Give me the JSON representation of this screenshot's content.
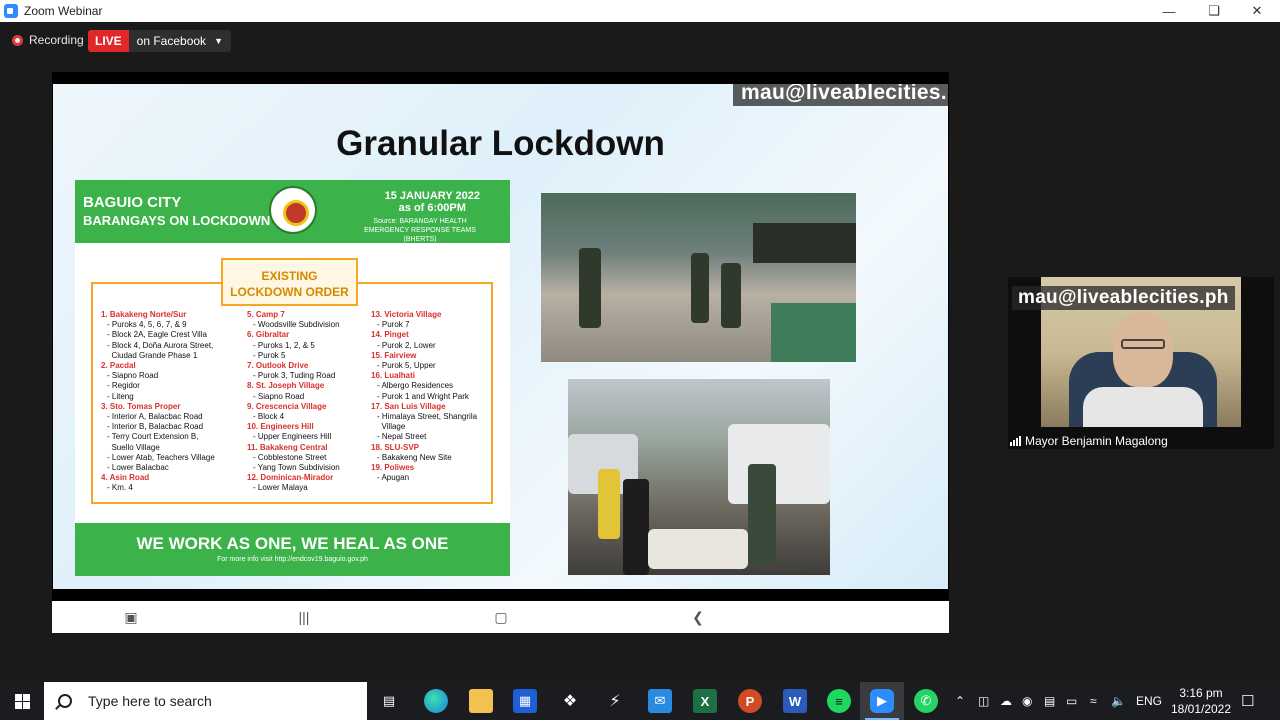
{
  "window": {
    "title": "Zoom Webinar"
  },
  "toolbar": {
    "recording_label": "Recording",
    "live_badge": "LIVE",
    "live_target": "on Facebook"
  },
  "slide": {
    "watermark_email": "mau@liveablecities.ph",
    "title": "Granular Lockdown",
    "poster": {
      "city": "BAGUIO CITY",
      "subtitle": "BARANGAYS ON LOCKDOWN",
      "date_line1": "15 JANUARY 2022",
      "date_line2": "as of 6:00PM",
      "source": "Source: BARANGAY HEALTH EMERGENCY RESPONSE TEAMS (BHERTS)",
      "order_title_1": "EXISTING",
      "order_title_2": "LOCKDOWN ORDER",
      "footer_main": "WE WORK AS ONE, WE HEAL AS ONE",
      "footer_info": "For more info visit http://endcov19.baguio.gov.ph",
      "col1": [
        {
          "h": "1. Bakakeng Norte/Sur"
        },
        {
          "t": "- Puroks 4, 5, 6, 7, & 9"
        },
        {
          "t": "- Block 2A, Eagle Crest Villa"
        },
        {
          "t": "- Block 4, Doña Aurora Street,"
        },
        {
          "t": "  Ciudad Grande Phase 1"
        },
        {
          "h": "2. Pacdal"
        },
        {
          "t": "- Siapno Road"
        },
        {
          "t": "- Regidor"
        },
        {
          "t": "- Liteng"
        },
        {
          "h": "3. Sto. Tomas Proper"
        },
        {
          "t": "- Interior A, Balacbac Road"
        },
        {
          "t": "- Interior B, Balacbac Road"
        },
        {
          "t": "- Terry Court Extension B,"
        },
        {
          "t": "  Suello Village"
        },
        {
          "t": "- Lower Atab, Teachers Village"
        },
        {
          "t": "- Lower Balacbac"
        },
        {
          "h": "4. Asin Road"
        },
        {
          "t": "- Km. 4"
        }
      ],
      "col2": [
        {
          "h": "5. Camp 7"
        },
        {
          "t": "- Woodsville Subdivision"
        },
        {
          "h": "6. Gibraltar"
        },
        {
          "t": "- Puroks 1, 2, & 5"
        },
        {
          "t": "- Purok 5"
        },
        {
          "h": "7. Outlook Drive"
        },
        {
          "t": "- Purok 3, Tuding Road"
        },
        {
          "h": "8. St. Joseph Village"
        },
        {
          "t": "- Siapno Road"
        },
        {
          "h": "9. Crescencia Village"
        },
        {
          "t": "- Block 4"
        },
        {
          "h": "10. Engineers Hill"
        },
        {
          "t": "- Upper Engineers Hill"
        },
        {
          "h": "11. Bakakeng Central"
        },
        {
          "t": "- Cobblestone Street"
        },
        {
          "t": "- Yang Town Subdivision"
        },
        {
          "h": "12. Dominican-Mirador"
        },
        {
          "t": "- Lower Malaya"
        }
      ],
      "col3": [
        {
          "h": "13. Victoria Village"
        },
        {
          "t": "- Purok 7"
        },
        {
          "h": "14. Pinget"
        },
        {
          "t": "- Purok 2, Lower"
        },
        {
          "h": "15. Fairview"
        },
        {
          "t": "- Purok 5, Upper"
        },
        {
          "h": "16. Lualhati"
        },
        {
          "t": "- Albergo Residences"
        },
        {
          "t": "- Purok 1 and Wright Park"
        },
        {
          "h": "17. San Luis Village"
        },
        {
          "t": "- Himalaya Street, Shangrila"
        },
        {
          "t": "  Village"
        },
        {
          "t": "- Nepal Street"
        },
        {
          "h": "18. SLU-SVP"
        },
        {
          "t": "- Bakakeng New Site"
        },
        {
          "h": "19. Poliwes"
        },
        {
          "t": "- Apugan"
        }
      ]
    }
  },
  "participant": {
    "name": "Mayor Benjamin Magalong",
    "watermark_email": "mau@liveablecities.ph"
  },
  "taskbar": {
    "search_placeholder": "Type here to search",
    "language": "ENG",
    "time": "3:16 pm",
    "date": "18/01/2022"
  }
}
